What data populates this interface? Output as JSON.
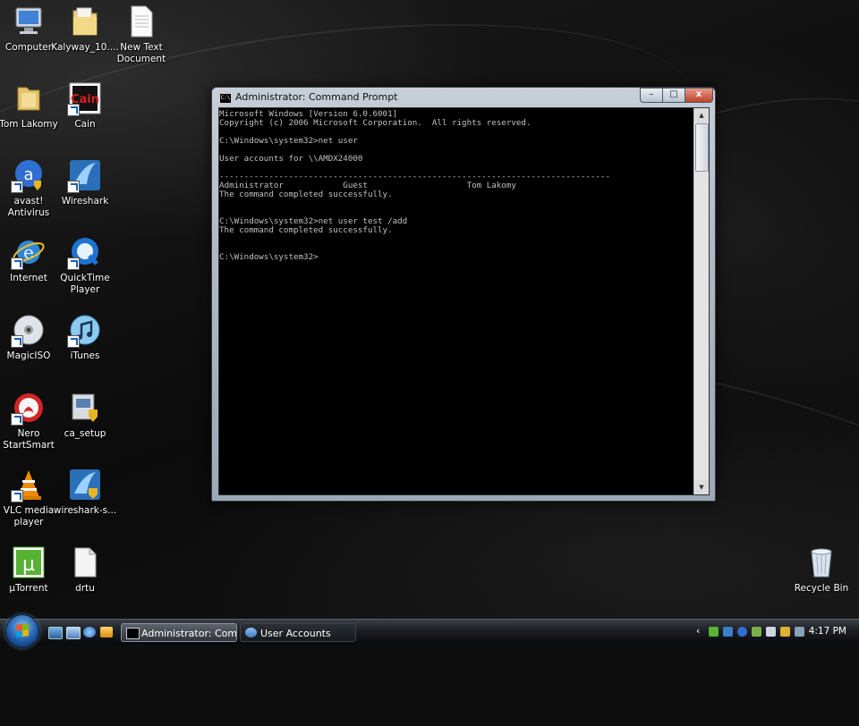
{
  "desktop_icons": [
    {
      "id": "computer",
      "label": "Computer",
      "icon": "computer-icon"
    },
    {
      "id": "kalyway",
      "label": "Kalyway_10....",
      "icon": "folder-icon"
    },
    {
      "id": "newtext",
      "label": "New Text Document",
      "icon": "text-document-icon"
    },
    {
      "id": "tomlakomy",
      "label": "Tom Lakomy",
      "icon": "user-folder-icon"
    },
    {
      "id": "cain",
      "label": "Cain",
      "icon": "cain-icon"
    },
    {
      "id": "avast",
      "label": "avast! Antivirus",
      "icon": "avast-icon"
    },
    {
      "id": "wireshark",
      "label": "Wireshark",
      "icon": "wireshark-icon"
    },
    {
      "id": "internet",
      "label": "Internet",
      "icon": "internet-explorer-icon"
    },
    {
      "id": "quicktime",
      "label": "QuickTime Player",
      "icon": "quicktime-icon"
    },
    {
      "id": "magiciso",
      "label": "MagicISO",
      "icon": "disc-icon"
    },
    {
      "id": "itunes",
      "label": "iTunes",
      "icon": "itunes-icon"
    },
    {
      "id": "nero",
      "label": "Nero StartSmart",
      "icon": "nero-icon"
    },
    {
      "id": "casetup",
      "label": "ca_setup",
      "icon": "setup-icon"
    },
    {
      "id": "vlc",
      "label": "VLC media player",
      "icon": "vlc-icon"
    },
    {
      "id": "wiresharksetup",
      "label": "wireshark-s...",
      "icon": "wireshark-icon"
    },
    {
      "id": "utorrent",
      "label": "µTorrent",
      "icon": "utorrent-icon"
    },
    {
      "id": "drtu",
      "label": "drtu",
      "icon": "file-icon"
    },
    {
      "id": "recyclebin",
      "label": "Recycle Bin",
      "icon": "recycle-bin-icon"
    }
  ],
  "cmd_window": {
    "title": "Administrator: Command Prompt",
    "lines": [
      "Microsoft Windows [Version 6.0.6001]",
      "Copyright (c) 2006 Microsoft Corporation.  All rights reserved.",
      "",
      "C:\\Windows\\system32>net user",
      "",
      "User accounts for \\\\AMDX24000",
      "",
      "-------------------------------------------------------------------------------",
      "Administrator            Guest                    Tom Lakomy",
      "The command completed successfully.",
      "",
      "",
      "C:\\Windows\\system32>net user test /add",
      "The command completed successfully.",
      "",
      "",
      "C:\\Windows\\system32>"
    ],
    "buttons": {
      "minimize": "–",
      "maximize": "□",
      "close": "x"
    },
    "text_color": "#c0c0c0",
    "background_color": "#000000"
  },
  "taskbar": {
    "quick_launch": [
      "show-desktop-icon",
      "switch-windows-icon",
      "internet-explorer-icon",
      "media-icon"
    ],
    "buttons": [
      {
        "label": "Administrator: Com...",
        "icon": "cmd-icon",
        "active": true
      },
      {
        "label": "User Accounts",
        "icon": "user-accounts-icon",
        "active": false
      }
    ],
    "tray_chevron": "‹",
    "tray_icons": [
      "utorrent-tray-icon",
      "network-icon",
      "avast-tray-icon",
      "safely-remove-icon",
      "volume-icon",
      "power-icon",
      "wireless-icon"
    ],
    "clock": "4:17 PM"
  }
}
